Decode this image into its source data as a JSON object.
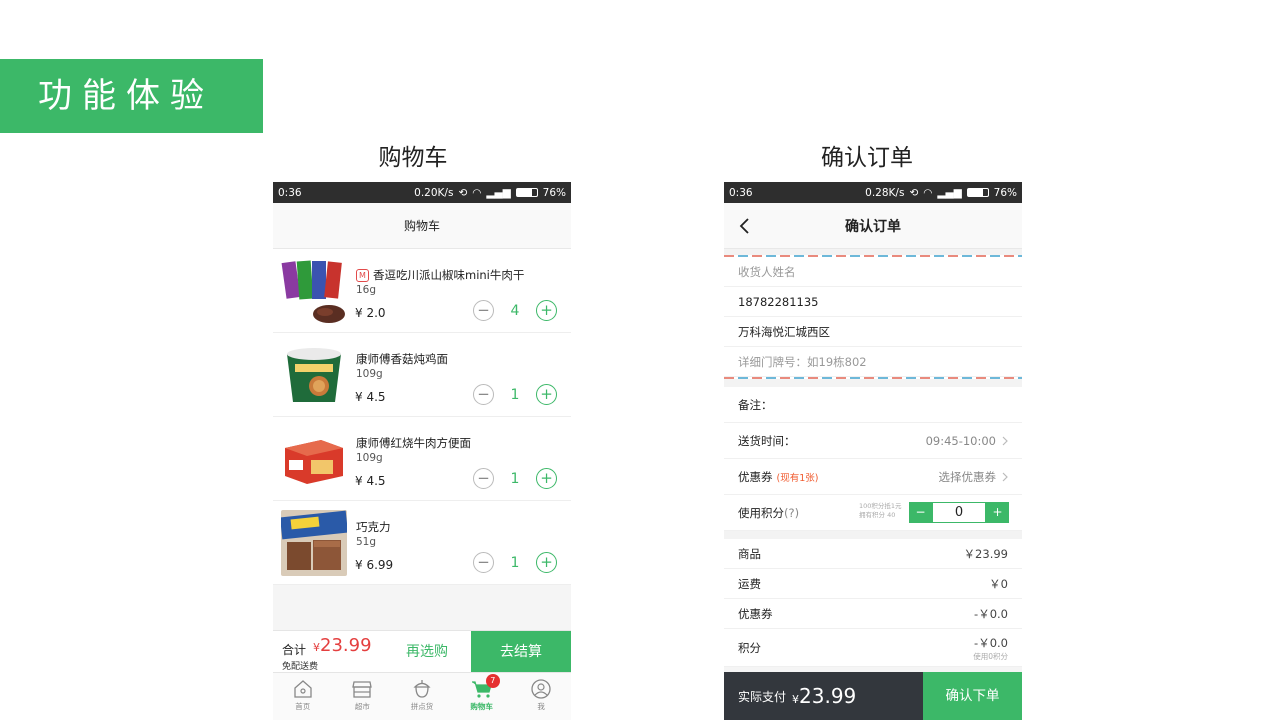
{
  "slide": {
    "title": "功能体验",
    "caption_left": "购物车",
    "caption_right": "确认订单"
  },
  "cart_screen": {
    "status": {
      "time": "0:36",
      "speed": "0.20K/s",
      "battery": "76%"
    },
    "title": "购物车",
    "items": [
      {
        "name": "香逗吃川派山椒味mini牛肉干",
        "mall_badge": "M",
        "weight": "16g",
        "price": "¥ 2.0",
        "qty": "4"
      },
      {
        "name": "康师傅香菇炖鸡面",
        "weight": "109g",
        "price": "¥ 4.5",
        "qty": "1"
      },
      {
        "name": "康师傅红烧牛肉方便面",
        "weight": "109g",
        "price": "¥ 4.5",
        "qty": "1"
      },
      {
        "name": "巧克力",
        "weight": "51g",
        "price": "¥ 6.99",
        "qty": "1"
      }
    ],
    "checkout": {
      "total_label": "合计",
      "currency": "¥",
      "total": "23.99",
      "free_shipping": "免配送费",
      "reselect": "再选购",
      "checkout": "去结算"
    },
    "tabs": [
      {
        "label": "首页",
        "icon": "home-icon"
      },
      {
        "label": "超市",
        "icon": "store-icon"
      },
      {
        "label": "拼点货",
        "icon": "acorn-icon"
      },
      {
        "label": "购物车",
        "icon": "cart-icon",
        "badge": "7",
        "active": true
      },
      {
        "label": "我",
        "icon": "user-icon"
      }
    ],
    "accent_color": "#3cb868",
    "price_color": "#e43f3f"
  },
  "order_screen": {
    "status": {
      "time": "0:36",
      "speed": "0.28K/s",
      "battery": "76%"
    },
    "title": "确认订单",
    "address": {
      "name_placeholder": "收货人姓名",
      "phone": "18782281135",
      "area": "万科海悦汇城西区",
      "detail_placeholder": "详细门牌号：如19栋802"
    },
    "remark_label": "备注：",
    "delivery_label": "送货时间：",
    "delivery_value": "09:45-10:00",
    "coupon_label": "优惠券",
    "coupon_note": "(现有1张)",
    "coupon_value": "选择优惠券",
    "points_label": "使用积分",
    "points_help": "(?)",
    "points_note_1": "100积分抵1元",
    "points_note_2": "拥有积分 40",
    "points_minus": "−",
    "points_value": "0",
    "points_plus": "+",
    "summary": [
      {
        "label": "商品",
        "value": "￥23.99"
      },
      {
        "label": "运费",
        "value": "￥0"
      },
      {
        "label": "优惠券",
        "value": "-￥0.0"
      }
    ],
    "points_row": {
      "label": "积分",
      "value": "-￥0.0",
      "sub": "使用0积分"
    },
    "pay": {
      "label": "实际支付",
      "currency": "¥",
      "amount": "23.99",
      "submit": "确认下单"
    }
  }
}
